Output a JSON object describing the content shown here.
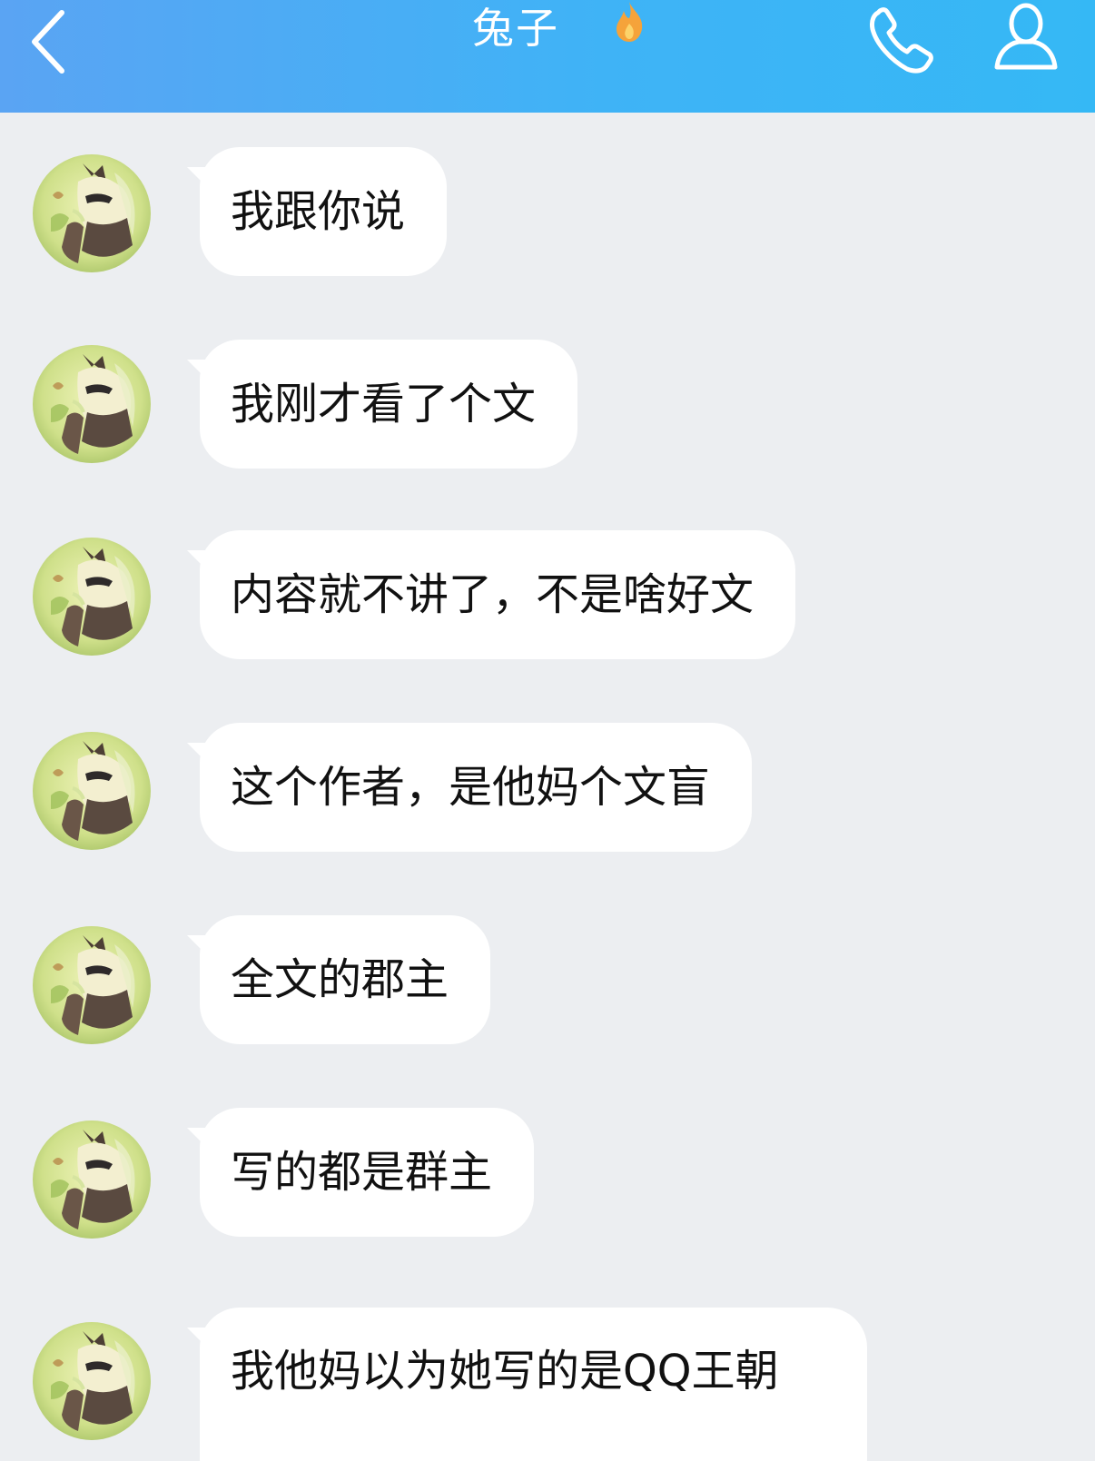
{
  "header": {
    "title": "兔子",
    "subtitle": "",
    "back_icon": "chevron-left-icon",
    "title_badge_icon": "fire-icon",
    "phone_icon": "phone-icon",
    "profile_icon": "profile-icon",
    "bar_color": "#3fb3f6"
  },
  "chat": {
    "background": "#eceef1",
    "bubble_color": "#ffffff",
    "messages": [
      {
        "sender": "兔子",
        "text": "我跟你说"
      },
      {
        "sender": "兔子",
        "text": "我刚才看了个文"
      },
      {
        "sender": "兔子",
        "text": "内容就不讲了，不是啥好文"
      },
      {
        "sender": "兔子",
        "text": "这个作者，是他妈个文盲"
      },
      {
        "sender": "兔子",
        "text": "全文的郡主"
      },
      {
        "sender": "兔子",
        "text": "写的都是群主"
      },
      {
        "sender": "兔子",
        "text": "我他妈以为她写的是QQ王朝"
      }
    ]
  }
}
